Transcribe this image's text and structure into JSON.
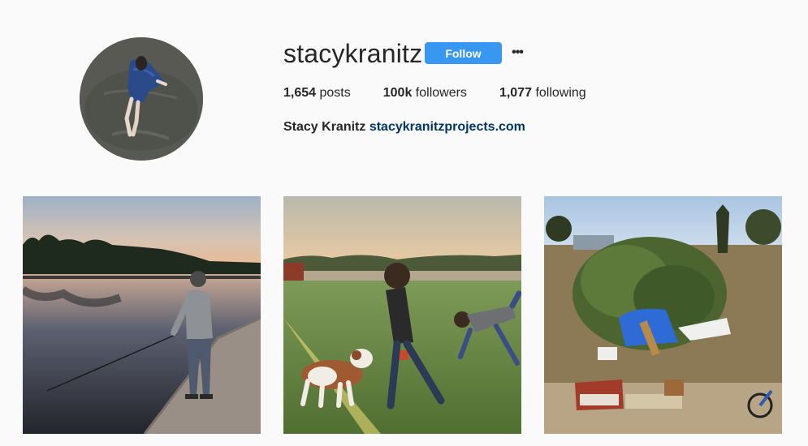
{
  "profile": {
    "username": "stacykranitz",
    "follow_label": "Follow",
    "more_label": "•••",
    "stats": {
      "posts_count": "1,654",
      "posts_label": "posts",
      "followers_count": "100k",
      "followers_label": "followers",
      "following_count": "1,077",
      "following_label": "following"
    },
    "bio": {
      "full_name": "Stacy Kranitz",
      "website": "stacykranitz­projects.com"
    },
    "accent_color": "#3897f0",
    "link_color": "#003569"
  },
  "posts": [
    {
      "icon": "photo-man-fishing-at-sunset"
    },
    {
      "icon": "photo-children-playing-with-dog"
    },
    {
      "icon": "photo-encampment-with-furniture"
    }
  ]
}
